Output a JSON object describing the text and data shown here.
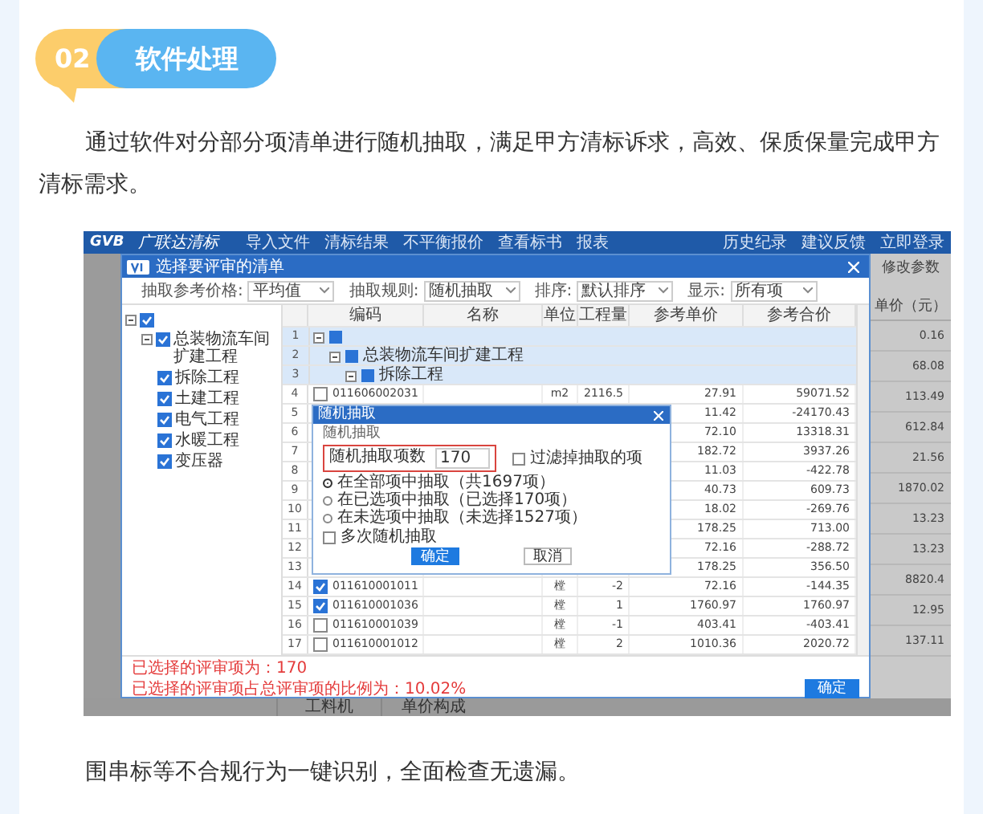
{
  "section": {
    "number": "02",
    "title": "软件处理"
  },
  "intro": "通过软件对分部分项清单进行随机抽取，满足甲方清标诉求，高效、保质保量完成甲方清标需求。",
  "screenshot": {
    "app": {
      "logo": "GVB",
      "name": "广联达清标",
      "menu": [
        "导入文件",
        "清标结果",
        "不平衡报价",
        "查看标书",
        "报表"
      ],
      "links": [
        "历史纪录",
        "建议反馈",
        "立即登录"
      ],
      "toolbar": "修改参数",
      "price_header": "单价（元）",
      "prices": [
        "0.16",
        "68.08",
        "113.49",
        "612.84",
        "21.56",
        "1870.02",
        "13.23",
        "13.23",
        "8820.4",
        "12.95",
        "137.11"
      ],
      "tabs": [
        "工料机",
        "单价构成"
      ]
    },
    "dialog": {
      "title": "选择要评审的清单",
      "filters": [
        {
          "label": "抽取参考价格:",
          "value": "平均值"
        },
        {
          "label": "抽取规则:",
          "value": "随机抽取"
        },
        {
          "label": "排序:",
          "value": "默认排序"
        },
        {
          "label": "显示:",
          "value": "所有项"
        }
      ],
      "tree": [
        {
          "checked": true,
          "children": [
            {
              "label": "总装物流车间扩建工程",
              "checked": true,
              "children": [
                {
                  "label": "拆除工程",
                  "checked": true
                },
                {
                  "label": "土建工程",
                  "checked": true
                },
                {
                  "label": "电气工程",
                  "checked": true
                },
                {
                  "label": "水暖工程",
                  "checked": true
                },
                {
                  "label": "变压器",
                  "checked": true
                }
              ]
            }
          ]
        }
      ],
      "table": {
        "columns": [
          "编码",
          "名称",
          "单位",
          "工程量",
          "参考单价",
          "参考合价"
        ],
        "rows": [
          {
            "index": "1",
            "kind": "group",
            "checked": true,
            "children": [
              {
                "index": "2",
                "kind": "group",
                "checked": true,
                "name": "总装物流车间扩建工程",
                "children": [
                  {
                    "index": "3",
                    "kind": "group",
                    "checked": true,
                    "name": "拆除工程",
                    "children": [
                      {
                        "index": "4",
                        "kind": "item",
                        "checked": false,
                        "code": "011606002031",
                        "unit": "m2",
                        "quantity": "2116.5",
                        "unit_price": "27.91",
                        "total": "59071.52"
                      },
                      {
                        "index": "5",
                        "kind": "item",
                        "unit_price": "11.42",
                        "total": "-24170.43"
                      },
                      {
                        "index": "6",
                        "kind": "item",
                        "unit_price": "72.10",
                        "total": "13318.31"
                      },
                      {
                        "index": "7",
                        "kind": "item",
                        "unit_price": "182.72",
                        "total": "3937.26"
                      },
                      {
                        "index": "8",
                        "kind": "item",
                        "unit_price": "11.03",
                        "total": "-422.78"
                      },
                      {
                        "index": "9",
                        "kind": "item",
                        "unit_price": "40.73",
                        "total": "609.73"
                      },
                      {
                        "index": "10",
                        "kind": "item",
                        "unit_price": "18.02",
                        "total": "-269.76"
                      },
                      {
                        "index": "11",
                        "kind": "item",
                        "unit_price": "178.25",
                        "total": "713.00"
                      },
                      {
                        "index": "12",
                        "kind": "item",
                        "unit_price": "72.16",
                        "total": "-288.72"
                      },
                      {
                        "index": "13",
                        "kind": "item",
                        "unit_price": "178.25",
                        "total": "356.50"
                      },
                      {
                        "index": "14",
                        "kind": "item",
                        "checked": true,
                        "code": "011610001011",
                        "unit": "樘",
                        "quantity": "-2",
                        "unit_price": "72.16",
                        "total": "-144.35"
                      },
                      {
                        "index": "15",
                        "kind": "item",
                        "checked": true,
                        "code": "011610001036",
                        "unit": "樘",
                        "quantity": "1",
                        "unit_price": "1760.97",
                        "total": "1760.97"
                      },
                      {
                        "index": "16",
                        "kind": "item",
                        "checked": false,
                        "code": "011610001039",
                        "unit": "樘",
                        "quantity": "-1",
                        "unit_price": "403.41",
                        "total": "-403.41"
                      },
                      {
                        "index": "17",
                        "kind": "item",
                        "checked": false,
                        "code": "011610001012",
                        "unit": "樘",
                        "quantity": "2",
                        "unit_price": "1010.36",
                        "total": "2020.72"
                      }
                    ]
                  }
                ]
              }
            ]
          }
        ]
      },
      "summary": [
        "已选择的评审项为：170",
        "已选择的评审项占总评审项的比例为：10.02%"
      ],
      "confirm": "确定"
    },
    "random_dialog": {
      "title": "随机抽取",
      "group": "随机抽取",
      "count_label": "随机抽取项数",
      "count": "170",
      "filter": {
        "label": "过滤掉抽取的项",
        "checked": false
      },
      "options": [
        {
          "label": "在全部项中抽取（共1697项）",
          "selected": true
        },
        {
          "label": "在已选项中抽取（已选择170项）",
          "selected": false
        },
        {
          "label": "在未选项中抽取（未选择1527项）",
          "selected": false
        }
      ],
      "repeat": {
        "label": "多次随机抽取",
        "checked": false
      },
      "buttons": [
        "确定",
        "取消"
      ]
    }
  },
  "outro": "围串标等不合规行为一键识别，全面检查无遗漏。"
}
